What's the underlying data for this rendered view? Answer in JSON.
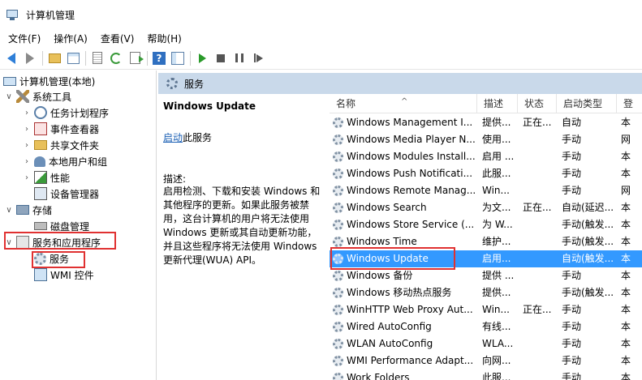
{
  "window": {
    "title": "计算机管理"
  },
  "menu": [
    "文件(F)",
    "操作(A)",
    "查看(V)",
    "帮助(H)"
  ],
  "tree": {
    "root": "计算机管理(本地)",
    "system_tools": "系统工具",
    "task_scheduler": "任务计划程序",
    "event_viewer": "事件查看器",
    "shared_folders": "共享文件夹",
    "local_users": "本地用户和组",
    "performance": "性能",
    "device_manager": "设备管理器",
    "storage": "存储",
    "disk_management": "磁盘管理",
    "services_apps": "服务和应用程序",
    "services": "服务",
    "wmi": "WMI 控件"
  },
  "pane": {
    "header": "服务",
    "detail_title": "Windows Update",
    "start_link": "启动",
    "start_suffix": "此服务",
    "desc_label": "描述:",
    "description": "启用检测、下载和安装 Windows 和其他程序的更新。如果此服务被禁用，这台计算机的用户将无法使用 Windows 更新或其自动更新功能，并且这些程序将无法使用 Windows 更新代理(WUA) API。"
  },
  "columns": {
    "name": "名称",
    "desc": "描述",
    "status": "状态",
    "startup": "启动类型",
    "login": "登"
  },
  "services": [
    {
      "name": "Windows Management I...",
      "desc": "提供...",
      "status": "正在...",
      "startup": "自动",
      "login": "本"
    },
    {
      "name": "Windows Media Player N...",
      "desc": "使用...",
      "status": "",
      "startup": "手动",
      "login": "网"
    },
    {
      "name": "Windows Modules Install...",
      "desc": "启用 ...",
      "status": "",
      "startup": "手动",
      "login": "本"
    },
    {
      "name": "Windows Push Notificati...",
      "desc": "此服...",
      "status": "",
      "startup": "手动",
      "login": "本"
    },
    {
      "name": "Windows Remote Manag...",
      "desc": "Win...",
      "status": "",
      "startup": "手动",
      "login": "网"
    },
    {
      "name": "Windows Search",
      "desc": "为文...",
      "status": "正在...",
      "startup": "自动(延迟...",
      "login": "本"
    },
    {
      "name": "Windows Store Service (...",
      "desc": "为 W...",
      "status": "",
      "startup": "手动(触发...",
      "login": "本"
    },
    {
      "name": "Windows Time",
      "desc": "维护...",
      "status": "",
      "startup": "手动(触发...",
      "login": "本"
    },
    {
      "name": "Windows Update",
      "desc": "启用...",
      "status": "",
      "startup": "自动(触发...",
      "login": "本",
      "selected": true
    },
    {
      "name": "Windows 备份",
      "desc": "提供 ...",
      "status": "",
      "startup": "手动",
      "login": "本"
    },
    {
      "name": "Windows 移动热点服务",
      "desc": "提供...",
      "status": "",
      "startup": "手动(触发...",
      "login": "本"
    },
    {
      "name": "WinHTTP Web Proxy Aut...",
      "desc": "Win...",
      "status": "正在...",
      "startup": "手动",
      "login": "本"
    },
    {
      "name": "Wired AutoConfig",
      "desc": "有线...",
      "status": "",
      "startup": "手动",
      "login": "本"
    },
    {
      "name": "WLAN AutoConfig",
      "desc": "WLA...",
      "status": "",
      "startup": "手动",
      "login": "本"
    },
    {
      "name": "WMI Performance Adapt...",
      "desc": "向网...",
      "status": "",
      "startup": "手动",
      "login": "本"
    },
    {
      "name": "Work Folders",
      "desc": "此服...",
      "status": "",
      "startup": "手动",
      "login": "本"
    }
  ]
}
